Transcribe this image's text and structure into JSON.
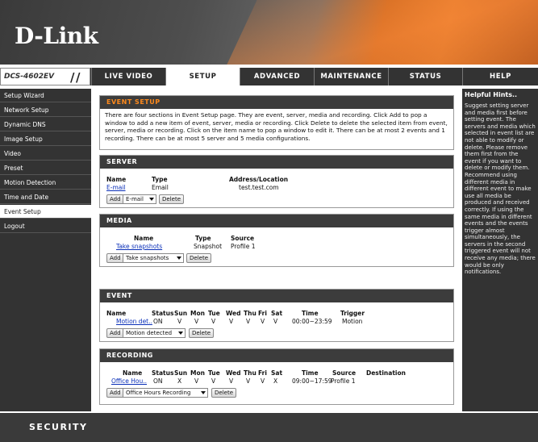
{
  "brand": {
    "logo_text": "D-Link",
    "accent": "#f08030",
    "dot_color": "#2aa8e0"
  },
  "model": "DCS-4602EV",
  "nav": {
    "tabs": [
      {
        "label": "LIVE VIDEO"
      },
      {
        "label": "SETUP"
      },
      {
        "label": "ADVANCED"
      },
      {
        "label": "MAINTENANCE"
      },
      {
        "label": "STATUS"
      },
      {
        "label": "HELP"
      }
    ],
    "active": "SETUP"
  },
  "sidebar": {
    "items": [
      {
        "label": "Setup Wizard"
      },
      {
        "label": "Network Setup"
      },
      {
        "label": "Dynamic DNS"
      },
      {
        "label": "Image Setup"
      },
      {
        "label": "Video"
      },
      {
        "label": "Preset"
      },
      {
        "label": "Motion Detection"
      },
      {
        "label": "Time and Date"
      },
      {
        "label": "Event Setup"
      },
      {
        "label": "Logout"
      }
    ],
    "active": "Event Setup"
  },
  "event_setup": {
    "title": "EVENT SETUP",
    "intro": "There are four sections in Event Setup page. They are event, server, media and recording. Click Add to pop a window to add a new item of event, server, media or recording. Click Delete to delete the selected item from event, server, media or recording. Click on the item name to pop a window to edit it. There can be at most 2 events and 1 recording. There can be at most 5 server and 5 media configurations."
  },
  "server": {
    "title": "SERVER",
    "headers": {
      "name": "Name",
      "type": "Type",
      "address": "Address/Location"
    },
    "row": {
      "name": "E-mail",
      "type": "Email",
      "address": "test.test.com"
    },
    "add": "Add",
    "select": "E-mail",
    "delete": "Delete"
  },
  "media": {
    "title": "MEDIA",
    "headers": {
      "name": "Name",
      "type": "Type",
      "source": "Source"
    },
    "row": {
      "name": "Take snapshots",
      "type": "Snapshot",
      "source": "Profile 1"
    },
    "add": "Add",
    "select": "Take snapshots",
    "delete": "Delete"
  },
  "event": {
    "title": "EVENT",
    "headers": [
      "Name",
      "Status",
      "Sun",
      "Mon",
      "Tue",
      "Wed",
      "Thu",
      "Fri",
      "Sat",
      "Time",
      "Trigger"
    ],
    "row": [
      "Motion det..",
      "ON",
      "V",
      "V",
      "V",
      "V",
      "V",
      "V",
      "V",
      "00:00~23:59",
      "Motion"
    ],
    "add": "Add",
    "select": "Motion detected",
    "delete": "Delete"
  },
  "recording": {
    "title": "RECORDING",
    "headers": [
      "Name",
      "Status",
      "Sun",
      "Mon",
      "Tue",
      "Wed",
      "Thu",
      "Fri",
      "Sat",
      "Time",
      "Source",
      "Destination"
    ],
    "row": [
      "Office Hou..",
      "ON",
      "X",
      "V",
      "V",
      "V",
      "V",
      "V",
      "X",
      "09:00~17:59",
      "Profile 1",
      ""
    ],
    "add": "Add",
    "select": "Office Hours Recording",
    "delete": "Delete"
  },
  "hints": {
    "title": "Helpful Hints..",
    "body": "Suggest setting server and media first before setting event. The servers and media which selected in event list are not able to modify or delete. Please remove them first from the event if you want to delete or modify them. Recommend using different media in different event to make use all media be produced and received correctly. If using the same media in different events and the events trigger almost simultaneously, the servers in the second triggered event will not receive any media; there would be only notifications."
  },
  "footer": {
    "text": "SECURITY"
  }
}
